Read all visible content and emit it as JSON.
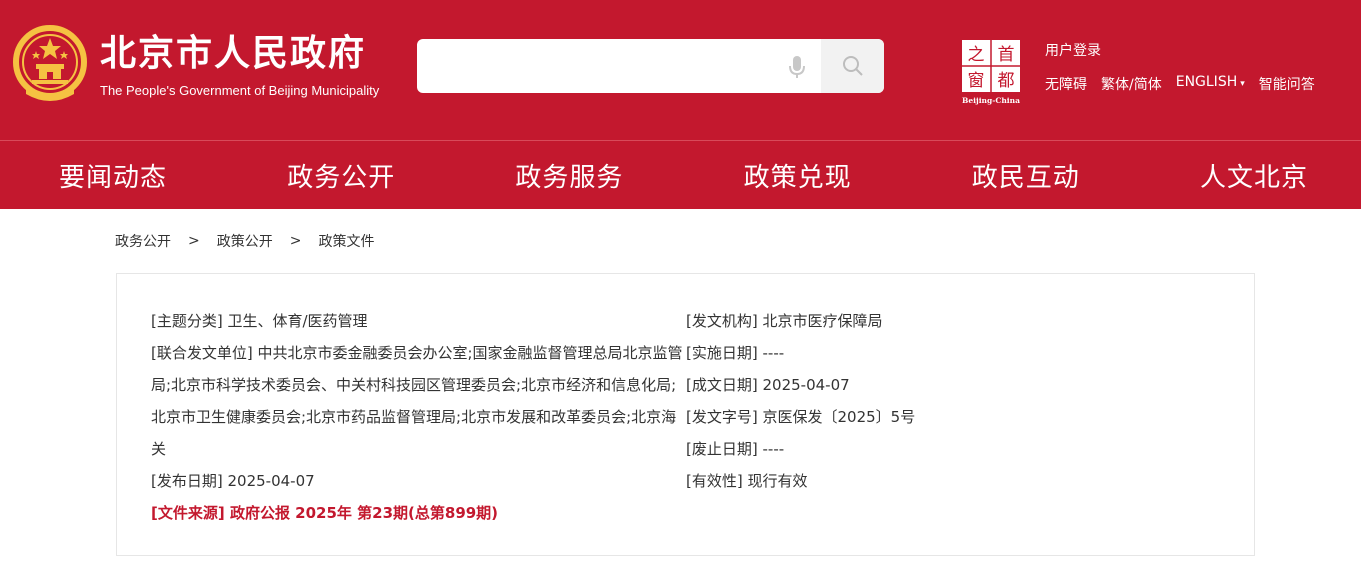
{
  "header": {
    "title": "北京市人民政府",
    "subtitle": "The People's Government of Beijing Municipality",
    "search": {
      "value": "",
      "placeholder": ""
    },
    "capital_logo": {
      "chars": [
        "之",
        "首",
        "窗",
        "都"
      ],
      "caption": "Beijing-China"
    },
    "login": "用户登录",
    "links": {
      "accessibility": "无障碍",
      "traditional": "繁体/简体",
      "english": "ENGLISH",
      "caret": "▾",
      "qa": "智能问答"
    }
  },
  "nav": {
    "items": [
      "要闻动态",
      "政务公开",
      "政务服务",
      "政策兑现",
      "政民互动",
      "人文北京"
    ]
  },
  "breadcrumb": {
    "items": [
      "政务公开",
      "政策公开",
      "政策文件"
    ],
    "separator": ">"
  },
  "info": {
    "topic_label": "[主题分类]",
    "topic_value": "卫生、体育/医药管理",
    "joint_label": "[联合发文单位]",
    "joint_value": "中共北京市委金融委员会办公室;国家金融监督管理总局北京监管局;北京市科学技术委员会、中关村科技园区管理委员会;北京市经济和信息化局;北京市卫生健康委员会;北京市药品监督管理局;北京市发展和改革委员会;北京海关",
    "publish_label": "[发布日期]",
    "publish_value": "2025-04-07",
    "source_label": "[文件来源]",
    "source_value": "政府公报 2025年 第23期(总第899期)",
    "issuer_label": "[发文机构]",
    "issuer_value": "北京市医疗保障局",
    "effective_label": "[实施日期]",
    "effective_value": "----",
    "created_label": "[成文日期]",
    "created_value": "2025-04-07",
    "docno_label": "[发文字号]",
    "docno_value": "京医保发〔2025〕5号",
    "repeal_label": "[废止日期]",
    "repeal_value": "----",
    "validity_label": "[有效性]",
    "validity_value": "现行有效"
  },
  "colors": {
    "brand_red": "#c3182e",
    "gold": "#f5c242"
  }
}
